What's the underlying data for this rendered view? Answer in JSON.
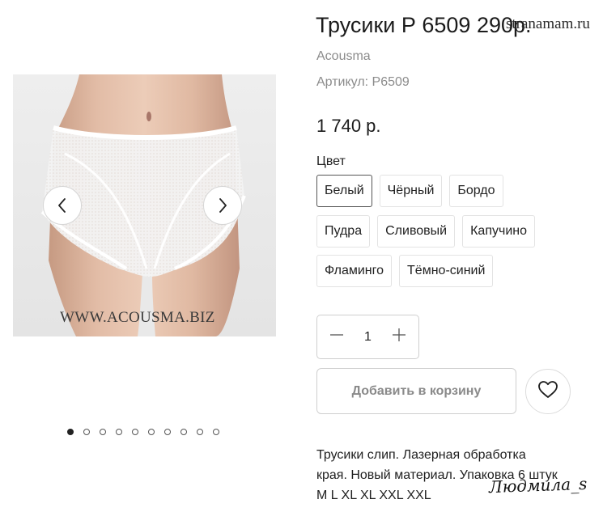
{
  "product": {
    "title": "Трусики Р 6509 290р.",
    "brand": "Acousma",
    "sku": "Артикул: Р6509",
    "price": "1 740 р."
  },
  "gallery": {
    "watermark": "WWW.ACOUSMA.BIZ",
    "prev_icon": "chevron-left-icon",
    "next_icon": "chevron-right-icon",
    "dots_total": 10,
    "active_dot": 0
  },
  "color": {
    "label": "Цвет",
    "options": [
      {
        "label": "Белый",
        "selected": true
      },
      {
        "label": "Чёрный",
        "selected": false
      },
      {
        "label": "Бордо",
        "selected": false
      },
      {
        "label": "Пудра",
        "selected": false
      },
      {
        "label": "Сливовый",
        "selected": false
      },
      {
        "label": "Капучино",
        "selected": false
      },
      {
        "label": "Фламинго",
        "selected": false
      },
      {
        "label": "Тёмно-синий",
        "selected": false
      }
    ]
  },
  "quantity": {
    "value": "1",
    "minus_icon": "minus-icon",
    "plus_icon": "plus-icon"
  },
  "actions": {
    "add_to_cart": "Добавить в корзину",
    "wishlist_icon": "heart-icon"
  },
  "description": "Трусики слип. Лазерная обработка края. Новый материал. Упаковка 6 штук M L XL XL XXL XXL",
  "overlay": {
    "site_stamp": "stranamam.ru",
    "signature": "Людмила_s"
  },
  "colors": {
    "text": "#222222",
    "muted": "#8c8c8c",
    "border": "#cfcfcf",
    "selected_border": "#555555"
  }
}
